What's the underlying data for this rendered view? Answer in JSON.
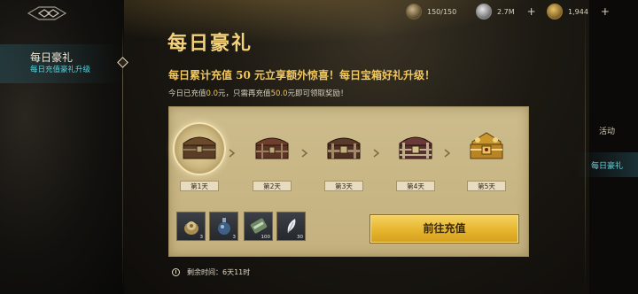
{
  "sidebar": {
    "active_item": {
      "title": "每日豪礼",
      "subtitle": "每日充值豪礼升级"
    }
  },
  "header": {
    "title": "每日豪礼",
    "promo": "每日累计充值 50 元立享额外惊喜！每日宝箱好礼升级！",
    "status_prefix": "今日已充值",
    "status_paid": "0.0",
    "status_mid": "元，只需再充值",
    "status_need": "50.0",
    "status_suffix": "元即可领取奖励！"
  },
  "currencies": [
    {
      "icon": "stamina-icon",
      "value": "150/150"
    },
    {
      "icon": "silver-coin-icon",
      "value": "2.7M"
    },
    {
      "icon": "gold-coin-icon",
      "value": "1,944"
    }
  ],
  "days": [
    {
      "label": "第1天",
      "selected": true
    },
    {
      "label": "第2天",
      "selected": false
    },
    {
      "label": "第3天",
      "selected": false
    },
    {
      "label": "第4天",
      "selected": false
    },
    {
      "label": "第5天",
      "selected": false
    }
  ],
  "rewards": [
    {
      "icon": "gem-pouch-icon",
      "count": "3"
    },
    {
      "icon": "potion-icon",
      "count": "3"
    },
    {
      "icon": "scroll-icon",
      "count": "100"
    },
    {
      "icon": "feather-icon",
      "count": "30"
    }
  ],
  "go_button": "前往充值",
  "timer": "剩余时间：6天11时",
  "right_tabs": [
    {
      "label": "活动",
      "active": false
    },
    {
      "label": "每日豪礼",
      "active": true
    }
  ],
  "colors": {
    "gold": "#f4d27a",
    "accent_teal": "#56d4e0",
    "button": "#e7b52e"
  }
}
